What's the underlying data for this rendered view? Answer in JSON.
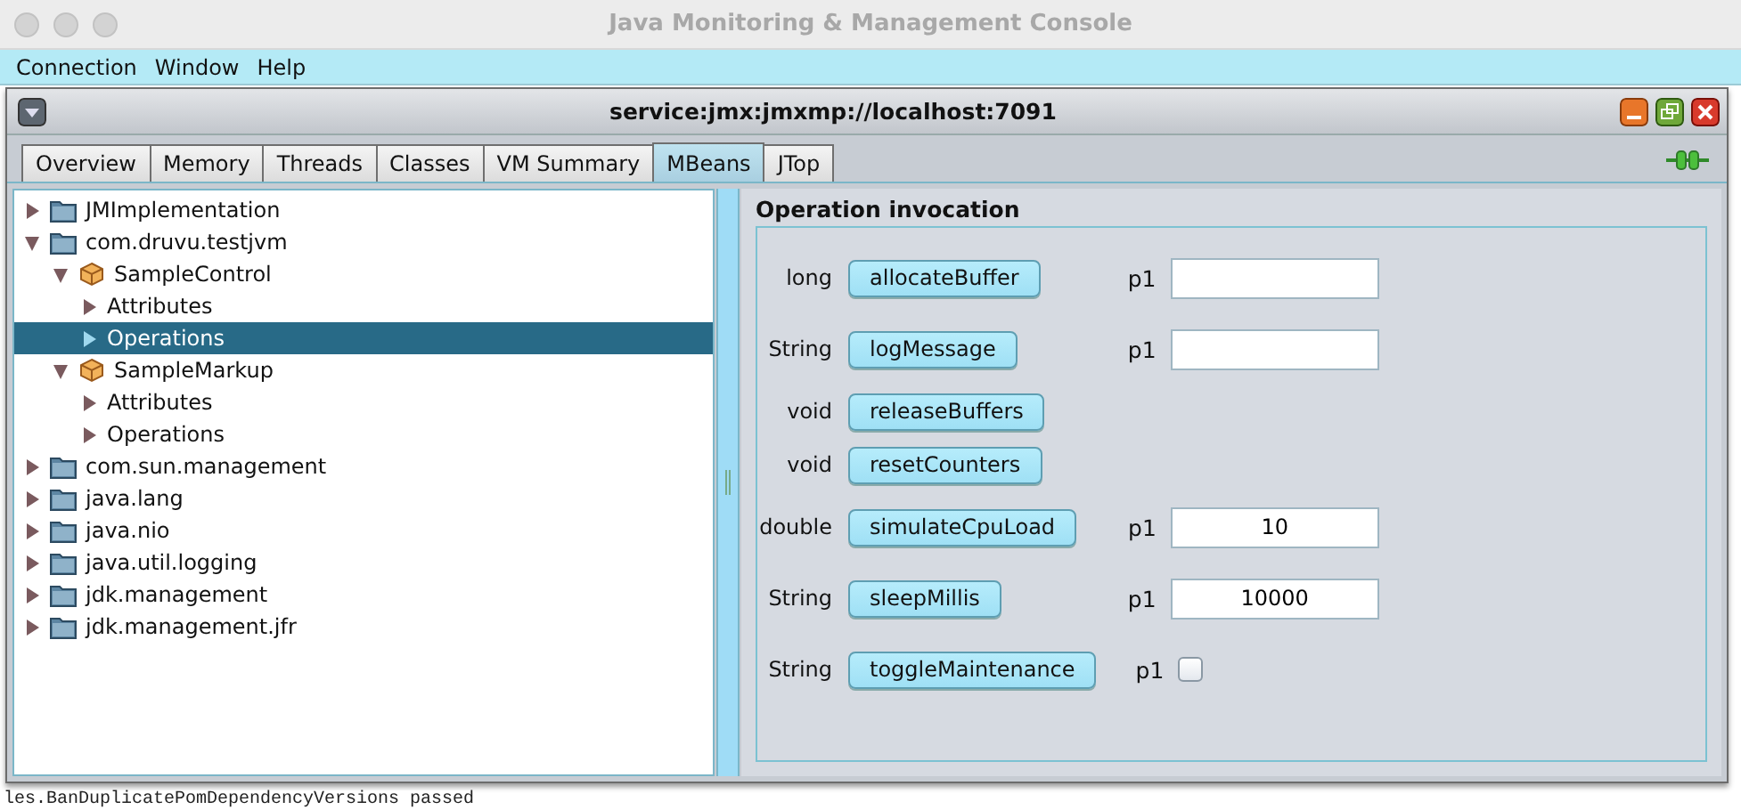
{
  "window": {
    "title": "Java Monitoring & Management Console"
  },
  "menu": [
    {
      "label": "Connection"
    },
    {
      "label": "Window"
    },
    {
      "label": "Help"
    }
  ],
  "frame": {
    "title": "service:jmx:jmxmp://localhost:7091"
  },
  "tabs": [
    {
      "label": "Overview",
      "selected": false
    },
    {
      "label": "Memory",
      "selected": false
    },
    {
      "label": "Threads",
      "selected": false
    },
    {
      "label": "Classes",
      "selected": false
    },
    {
      "label": "VM Summary",
      "selected": false
    },
    {
      "label": "MBeans",
      "selected": true
    },
    {
      "label": "JTop",
      "selected": false
    }
  ],
  "tree": [
    {
      "label": "JMImplementation",
      "kind": "folder",
      "expanded": false,
      "selected": false
    },
    {
      "label": "com.druvu.testjvm",
      "kind": "folder",
      "expanded": true,
      "selected": false,
      "children": [
        {
          "label": "SampleControl",
          "kind": "bean",
          "expanded": true,
          "selected": false,
          "children": [
            {
              "label": "Attributes",
              "expanded": false,
              "selected": false
            },
            {
              "label": "Operations",
              "expanded": false,
              "selected": true
            }
          ]
        },
        {
          "label": "SampleMarkup",
          "kind": "bean",
          "expanded": true,
          "selected": false,
          "children": [
            {
              "label": "Attributes",
              "expanded": false,
              "selected": false
            },
            {
              "label": "Operations",
              "expanded": false,
              "selected": false
            }
          ]
        }
      ]
    },
    {
      "label": "com.sun.management",
      "kind": "folder",
      "expanded": false,
      "selected": false
    },
    {
      "label": "java.lang",
      "kind": "folder",
      "expanded": false,
      "selected": false
    },
    {
      "label": "java.nio",
      "kind": "folder",
      "expanded": false,
      "selected": false
    },
    {
      "label": "java.util.logging",
      "kind": "folder",
      "expanded": false,
      "selected": false
    },
    {
      "label": "jdk.management",
      "kind": "folder",
      "expanded": false,
      "selected": false
    },
    {
      "label": "jdk.management.jfr",
      "kind": "folder",
      "expanded": false,
      "selected": false
    }
  ],
  "operations": {
    "title": "Operation invocation",
    "items": [
      {
        "return_type": "long",
        "name": "allocateBuffer",
        "params": [
          {
            "label": "p1",
            "kind": "text"
          }
        ]
      },
      {
        "return_type": "String",
        "name": "logMessage",
        "params": [
          {
            "label": "p1",
            "kind": "text"
          }
        ]
      },
      {
        "return_type": "void",
        "name": "releaseBuffers"
      },
      {
        "return_type": "void",
        "name": "resetCounters"
      },
      {
        "return_type": "double",
        "name": "simulateCpuLoad",
        "params": [
          {
            "label": "p1",
            "kind": "text",
            "value": "10"
          }
        ]
      },
      {
        "return_type": "String",
        "name": "sleepMillis",
        "params": [
          {
            "label": "p1",
            "kind": "text",
            "value": "10000"
          }
        ]
      },
      {
        "return_type": "String",
        "name": "toggleMaintenance",
        "params": [
          {
            "label": "p1",
            "kind": "checkbox",
            "checked": false
          }
        ]
      }
    ]
  },
  "background_text": "les.BanDuplicatePomDependencyVersions passed"
}
